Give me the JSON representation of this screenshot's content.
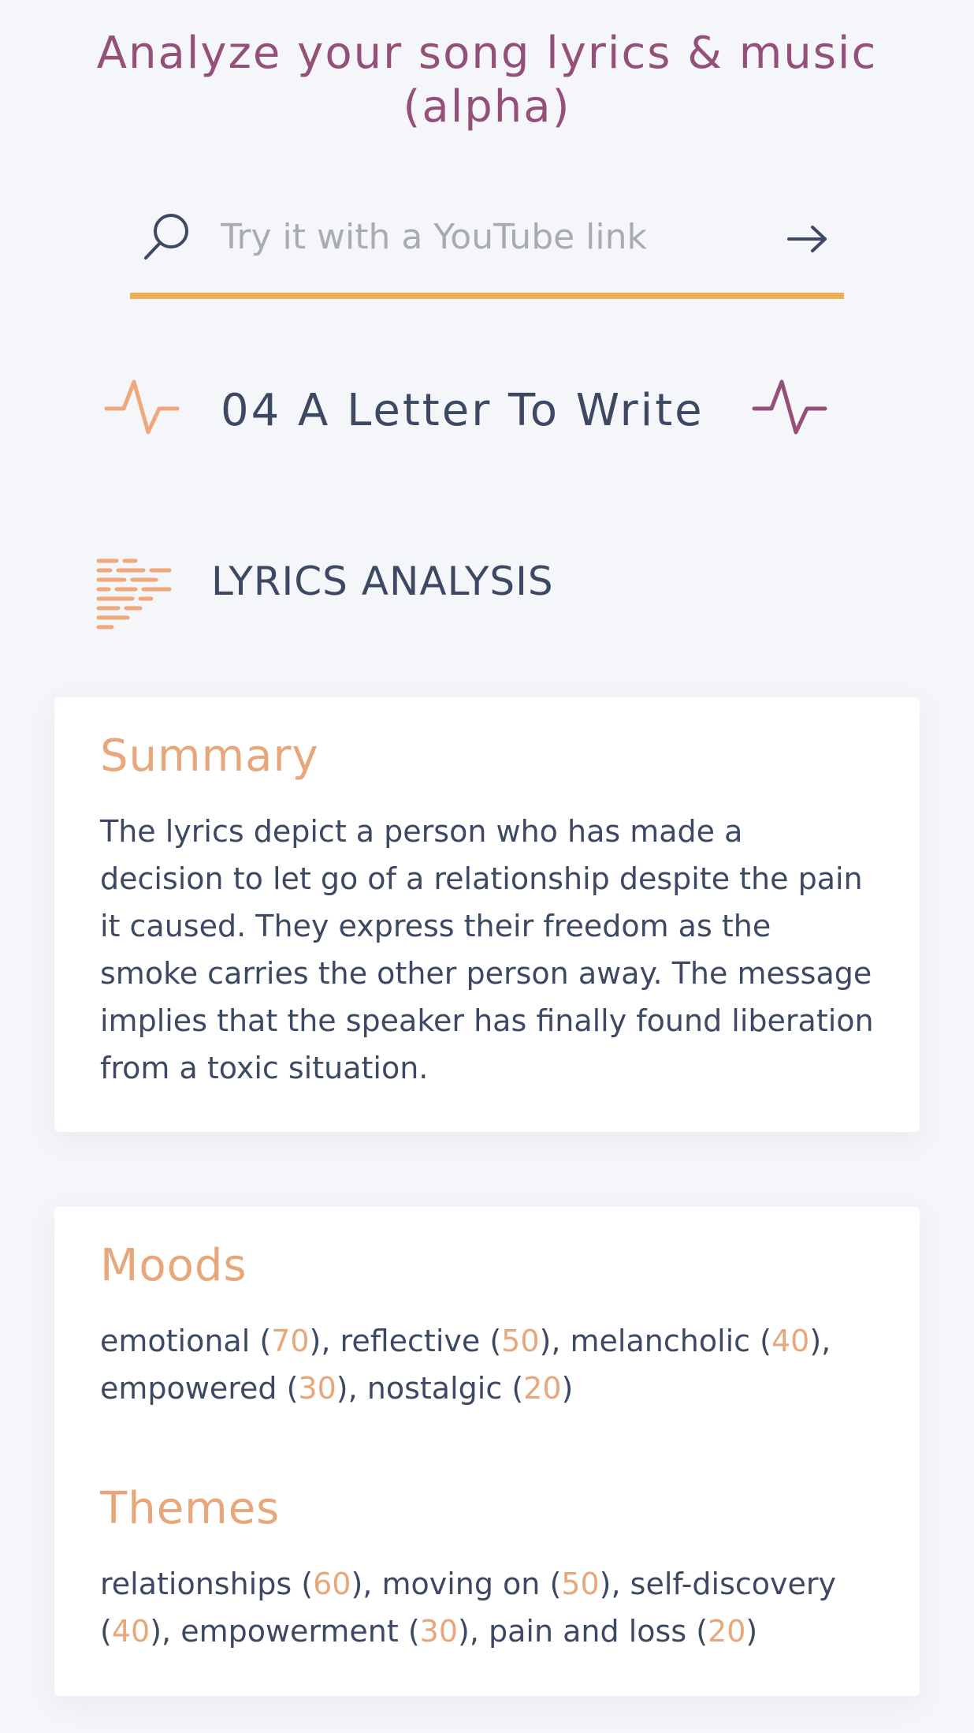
{
  "header": {
    "title": "Analyze your song lyrics & music (alpha)"
  },
  "search": {
    "placeholder": "Try it with a YouTube link",
    "value": "",
    "search_icon": "search-icon",
    "submit_icon": "arrow-right-icon"
  },
  "song": {
    "title": "04 A Letter To Write",
    "left_icon": "pulse-icon",
    "right_icon": "pulse-icon"
  },
  "section": {
    "title": "LYRICS ANALYSIS",
    "icon": "lyrics-lines-icon"
  },
  "summary": {
    "heading": "Summary",
    "text": "The lyrics depict a person who has made a decision to let go of a relationship despite the pain it caused. They express their freedom as the smoke carries the other person away. The message implies that the speaker has finally found liberation from a toxic situation."
  },
  "moods": {
    "heading": "Moods",
    "items": [
      {
        "label": "emotional",
        "score": "70"
      },
      {
        "label": "reflective",
        "score": "50"
      },
      {
        "label": "melancholic",
        "score": "40"
      },
      {
        "label": "empowered",
        "score": "30"
      },
      {
        "label": "nostalgic",
        "score": "20"
      }
    ]
  },
  "themes": {
    "heading": "Themes",
    "items": [
      {
        "label": "relationships",
        "score": "60"
      },
      {
        "label": "moving on",
        "score": "50"
      },
      {
        "label": "self-discovery",
        "score": "40"
      },
      {
        "label": "empowerment",
        "score": "30"
      },
      {
        "label": "pain and loss",
        "score": "20"
      }
    ]
  },
  "colors": {
    "background": "#f5f6fa",
    "title": "#95507a",
    "accent_orange": "#f0ae57",
    "score_peach": "#e8a77a",
    "text_dark": "#3d4863",
    "pulse_left": "#f0a77a",
    "pulse_right": "#95507a"
  }
}
